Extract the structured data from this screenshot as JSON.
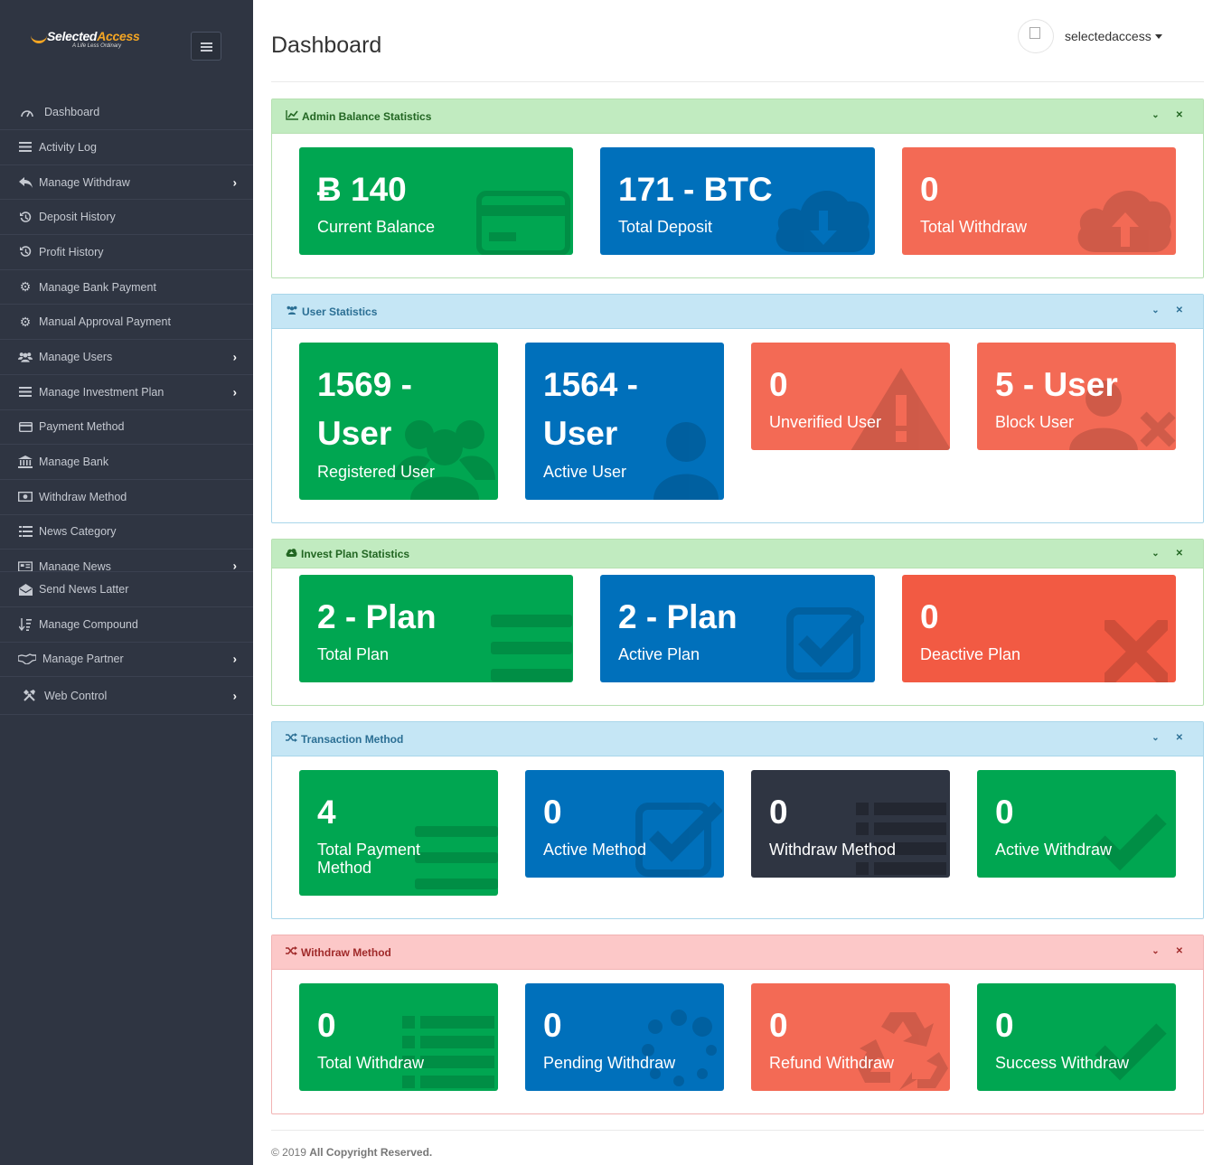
{
  "brand": {
    "name_part1": "Selected",
    "name_part2": "Access",
    "tagline": "A Life Less Ordinary"
  },
  "sidebar": {
    "items": [
      {
        "label": "Dashboard",
        "icon": "gauge-icon",
        "has_submenu": false
      },
      {
        "label": "Activity Log",
        "icon": "list-icon",
        "has_submenu": false
      },
      {
        "label": "Manage Withdraw",
        "icon": "reply-icon",
        "has_submenu": true
      },
      {
        "label": "Deposit History",
        "icon": "history-icon",
        "has_submenu": false
      },
      {
        "label": "Profit History",
        "icon": "history-icon",
        "has_submenu": false
      },
      {
        "label": "Manage Bank Payment",
        "icon": "gear-icon",
        "has_submenu": false
      },
      {
        "label": "Manual Approval Payment",
        "icon": "gear-icon",
        "has_submenu": false
      },
      {
        "label": "Manage Users",
        "icon": "users-icon",
        "has_submenu": true
      },
      {
        "label": "Manage Investment Plan",
        "icon": "list-icon",
        "has_submenu": true
      },
      {
        "label": "Payment Method",
        "icon": "credit-card-icon",
        "has_submenu": false
      },
      {
        "label": "Manage Bank",
        "icon": "bank-icon",
        "has_submenu": false
      },
      {
        "label": "Withdraw Method",
        "icon": "money-icon",
        "has_submenu": false
      },
      {
        "label": "News Category",
        "icon": "list-icon",
        "has_submenu": false
      },
      {
        "label": "Manage News",
        "icon": "newspaper-icon",
        "has_submenu": true
      },
      {
        "label": "Send News Latter",
        "icon": "envelope-open-icon",
        "has_submenu": false
      },
      {
        "label": "Manage Compound",
        "icon": "sort-icon",
        "has_submenu": false
      },
      {
        "label": "Manage Partner",
        "icon": "handshake-icon",
        "has_submenu": true
      },
      {
        "label": "Web Control",
        "icon": "tools-icon",
        "has_submenu": true
      }
    ]
  },
  "header": {
    "title": "Dashboard",
    "username": "selectedaccess"
  },
  "panels": {
    "admin_balance": {
      "title": "Admin Balance Statistics",
      "cards": [
        {
          "value": "Ƀ 140",
          "label": "Current Balance"
        },
        {
          "value": "171 - BTC",
          "label": "Total Deposit"
        },
        {
          "value": "0",
          "label": "Total Withdraw"
        }
      ]
    },
    "user_stats": {
      "title": "User Statistics",
      "cards": [
        {
          "value_line1": "1569 -",
          "value_line2": "User",
          "label": "Registered User"
        },
        {
          "value_line1": "1564 -",
          "value_line2": "User",
          "label": "Active User"
        },
        {
          "value": "0",
          "label": "Unverified User"
        },
        {
          "value": "5 - User",
          "label": "Block User"
        }
      ]
    },
    "invest_plan": {
      "title": "Invest Plan Statistics",
      "cards": [
        {
          "value": "2 - Plan",
          "label": "Total Plan"
        },
        {
          "value": "2 - Plan",
          "label": "Active Plan"
        },
        {
          "value": "0",
          "label": "Deactive Plan"
        }
      ]
    },
    "transaction_method": {
      "title": "Transaction Method",
      "cards": [
        {
          "value": "4",
          "label_line1": "Total Payment",
          "label_line2": "Method"
        },
        {
          "value": "0",
          "label": "Active Method"
        },
        {
          "value": "0",
          "label": "Withdraw Method"
        },
        {
          "value": "0",
          "label": "Active Withdraw"
        }
      ]
    },
    "withdraw_method": {
      "title": "Withdraw Method",
      "cards": [
        {
          "value": "0",
          "label": "Total Withdraw"
        },
        {
          "value": "0",
          "label": "Pending Withdraw"
        },
        {
          "value": "0",
          "label": "Refund Withdraw"
        },
        {
          "value": "0",
          "label": "Success Withdraw"
        }
      ]
    }
  },
  "footer": {
    "year": "© 2019",
    "text": "All Copyright Reserved."
  },
  "colors": {
    "sidebar": "#2f3542",
    "green": "#00a651",
    "blue": "#0070bb",
    "salmon": "#f36a55",
    "dark": "#2f3542",
    "red": "#f25a43"
  }
}
